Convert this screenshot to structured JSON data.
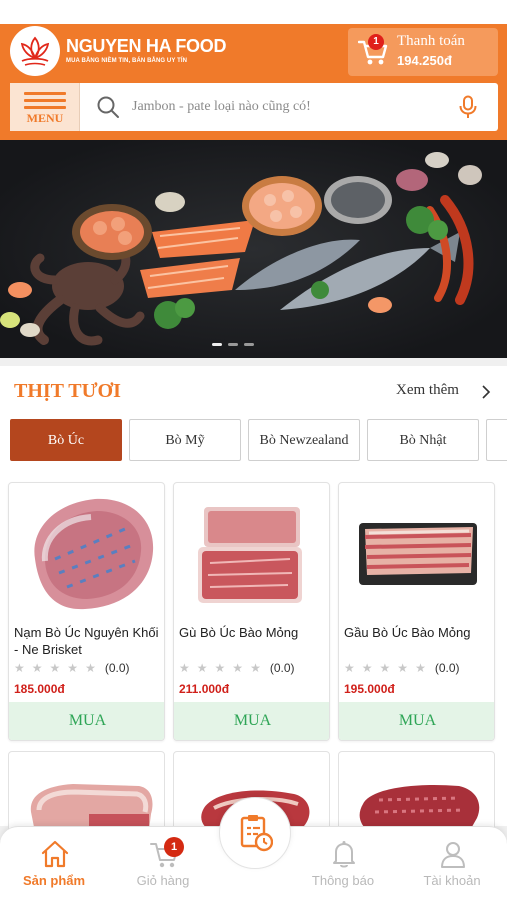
{
  "header": {
    "brand_name": "NGUYEN HA FOOD",
    "brand_slogan": "MUA BẰNG NIỀM TIN, BÁN BẰNG UY TÍN",
    "cart_badge": "1",
    "checkout_label": "Thanh toán",
    "checkout_total": "194.250đ",
    "accent_color": "#f07a2a"
  },
  "search": {
    "menu_label": "MENU",
    "placeholder": "Jambon - pate loại nào cũng có!",
    "value": ""
  },
  "banner": {
    "slides": 3,
    "active_slide": 1
  },
  "section": {
    "title": "THỊT TƯƠI",
    "see_more": "Xem thêm",
    "tabs": [
      {
        "label": "Bò Úc",
        "active": true
      },
      {
        "label": "Bò Mỹ",
        "active": false
      },
      {
        "label": "Bò Newzealand",
        "active": false
      },
      {
        "label": "Bò Nhật",
        "active": false
      }
    ]
  },
  "products": [
    {
      "name": "Nạm Bò Úc Nguyên Khối - Ne Brisket",
      "rating": "(0.0)",
      "price": "185.000đ",
      "buy_label": "MUA"
    },
    {
      "name": "Gù Bò Úc Bào Mỏng",
      "rating": "(0.0)",
      "price": "211.000đ",
      "buy_label": "MUA"
    },
    {
      "name": "Gầu Bò Úc Bào Mỏng",
      "rating": "(0.0)",
      "price": "195.000đ",
      "buy_label": "MUA"
    }
  ],
  "bottom_nav": {
    "items": [
      {
        "label": "Sản phẩm",
        "icon": "home-icon",
        "active": true
      },
      {
        "label": "Giỏ hàng",
        "icon": "cart-icon",
        "badge": "1",
        "active": false
      },
      {
        "label": "",
        "icon": "order-list-icon",
        "active": false
      },
      {
        "label": "Thông báo",
        "icon": "bell-icon",
        "active": false
      },
      {
        "label": "Tài khoản",
        "icon": "user-icon",
        "active": false
      }
    ]
  }
}
